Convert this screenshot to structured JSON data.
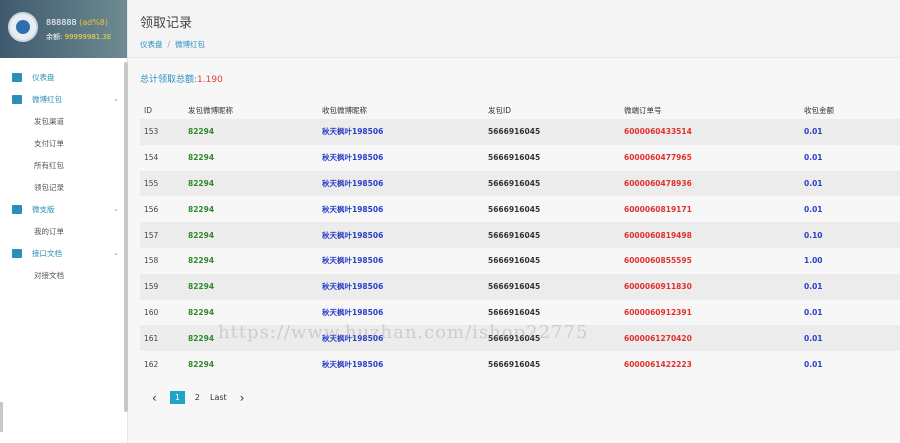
{
  "profile": {
    "name": "888888",
    "tag": "(ad%8)",
    "balance_label": "余额:",
    "balance_value": "99999981.3E"
  },
  "sidebar": {
    "items": [
      {
        "label": "仪表盘",
        "expandable": false
      },
      {
        "label": "微博红包",
        "expandable": true
      },
      {
        "label": "发包渠道",
        "sub": true
      },
      {
        "label": "支付订单",
        "sub": true
      },
      {
        "label": "所有红包",
        "sub": true
      },
      {
        "label": "领包记录",
        "sub": true
      },
      {
        "label": "微支版",
        "expandable": true
      },
      {
        "label": "我的订单",
        "sub": true
      },
      {
        "label": "接口文档",
        "expandable": true
      },
      {
        "label": "对接文档",
        "sub": true
      }
    ]
  },
  "header": {
    "title": "领取记录",
    "crumb_home": "仪表盘",
    "crumb_current": "微博红包"
  },
  "summary": {
    "label": "总计领取总额:",
    "value": "1.190"
  },
  "table": {
    "columns": [
      "ID",
      "发包微博昵称",
      "收包微博昵称",
      "发包ID",
      "微端订单号",
      "收包金额"
    ],
    "rows": [
      {
        "id": "153",
        "sender": "82294",
        "receiver": "秋天枫叶198506",
        "sender_id": "5666916045",
        "order": "6000060433514",
        "amount": "0.01"
      },
      {
        "id": "154",
        "sender": "82294",
        "receiver": "秋天枫叶198506",
        "sender_id": "5666916045",
        "order": "6000060477965",
        "amount": "0.01"
      },
      {
        "id": "155",
        "sender": "82294",
        "receiver": "秋天枫叶198506",
        "sender_id": "5666916045",
        "order": "6000060478936",
        "amount": "0.01"
      },
      {
        "id": "156",
        "sender": "82294",
        "receiver": "秋天枫叶198506",
        "sender_id": "5666916045",
        "order": "6000060819171",
        "amount": "0.01"
      },
      {
        "id": "157",
        "sender": "82294",
        "receiver": "秋天枫叶198506",
        "sender_id": "5666916045",
        "order": "6000060819498",
        "amount": "0.10"
      },
      {
        "id": "158",
        "sender": "82294",
        "receiver": "秋天枫叶198506",
        "sender_id": "5666916045",
        "order": "6000060855595",
        "amount": "1.00"
      },
      {
        "id": "159",
        "sender": "82294",
        "receiver": "秋天枫叶198506",
        "sender_id": "5666916045",
        "order": "6000060911830",
        "amount": "0.01"
      },
      {
        "id": "160",
        "sender": "82294",
        "receiver": "秋天枫叶198506",
        "sender_id": "5666916045",
        "order": "6000060912391",
        "amount": "0.01"
      },
      {
        "id": "161",
        "sender": "82294",
        "receiver": "秋天枫叶198506",
        "sender_id": "5666916045",
        "order": "6000061270420",
        "amount": "0.01"
      },
      {
        "id": "162",
        "sender": "82294",
        "receiver": "秋天枫叶198506",
        "sender_id": "5666916045",
        "order": "6000061422223",
        "amount": "0.01"
      }
    ]
  },
  "pager": {
    "prev": "‹",
    "pages": [
      "1",
      "2"
    ],
    "last": "Last",
    "next": "›"
  },
  "watermark": "https://www.huzhan.com/ishop22775",
  "colors": {
    "accent": "#2a8fbd",
    "sender": "#2e8b2e",
    "receiver": "#2a3fc8",
    "order": "#e03030",
    "pager_active": "#1fa3c8"
  }
}
